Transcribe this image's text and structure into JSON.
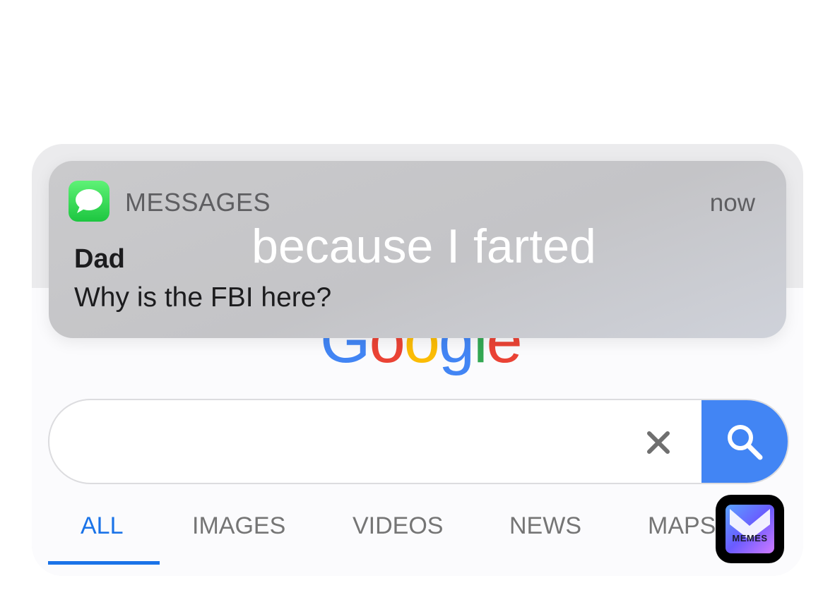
{
  "notification": {
    "app_name": "MESSAGES",
    "time": "now",
    "sender": "Dad",
    "message": "Why is the FBI here?",
    "icon": "messages-app-icon",
    "icon_color": "#34c759"
  },
  "caption": "because I farted",
  "google": {
    "logo_visible": "Google",
    "search": {
      "value": "",
      "placeholder": ""
    },
    "clear_icon": "close-icon",
    "search_icon": "search-icon",
    "accent": "#4285f4",
    "tabs": [
      {
        "label": "ALL",
        "active": true
      },
      {
        "label": "IMAGES",
        "active": false
      },
      {
        "label": "VIDEOS",
        "active": false
      },
      {
        "label": "NEWS",
        "active": false
      },
      {
        "label": "MAPS",
        "active": false
      }
    ],
    "active_color": "#1a73e8"
  },
  "watermark": {
    "label": "MEMES"
  }
}
